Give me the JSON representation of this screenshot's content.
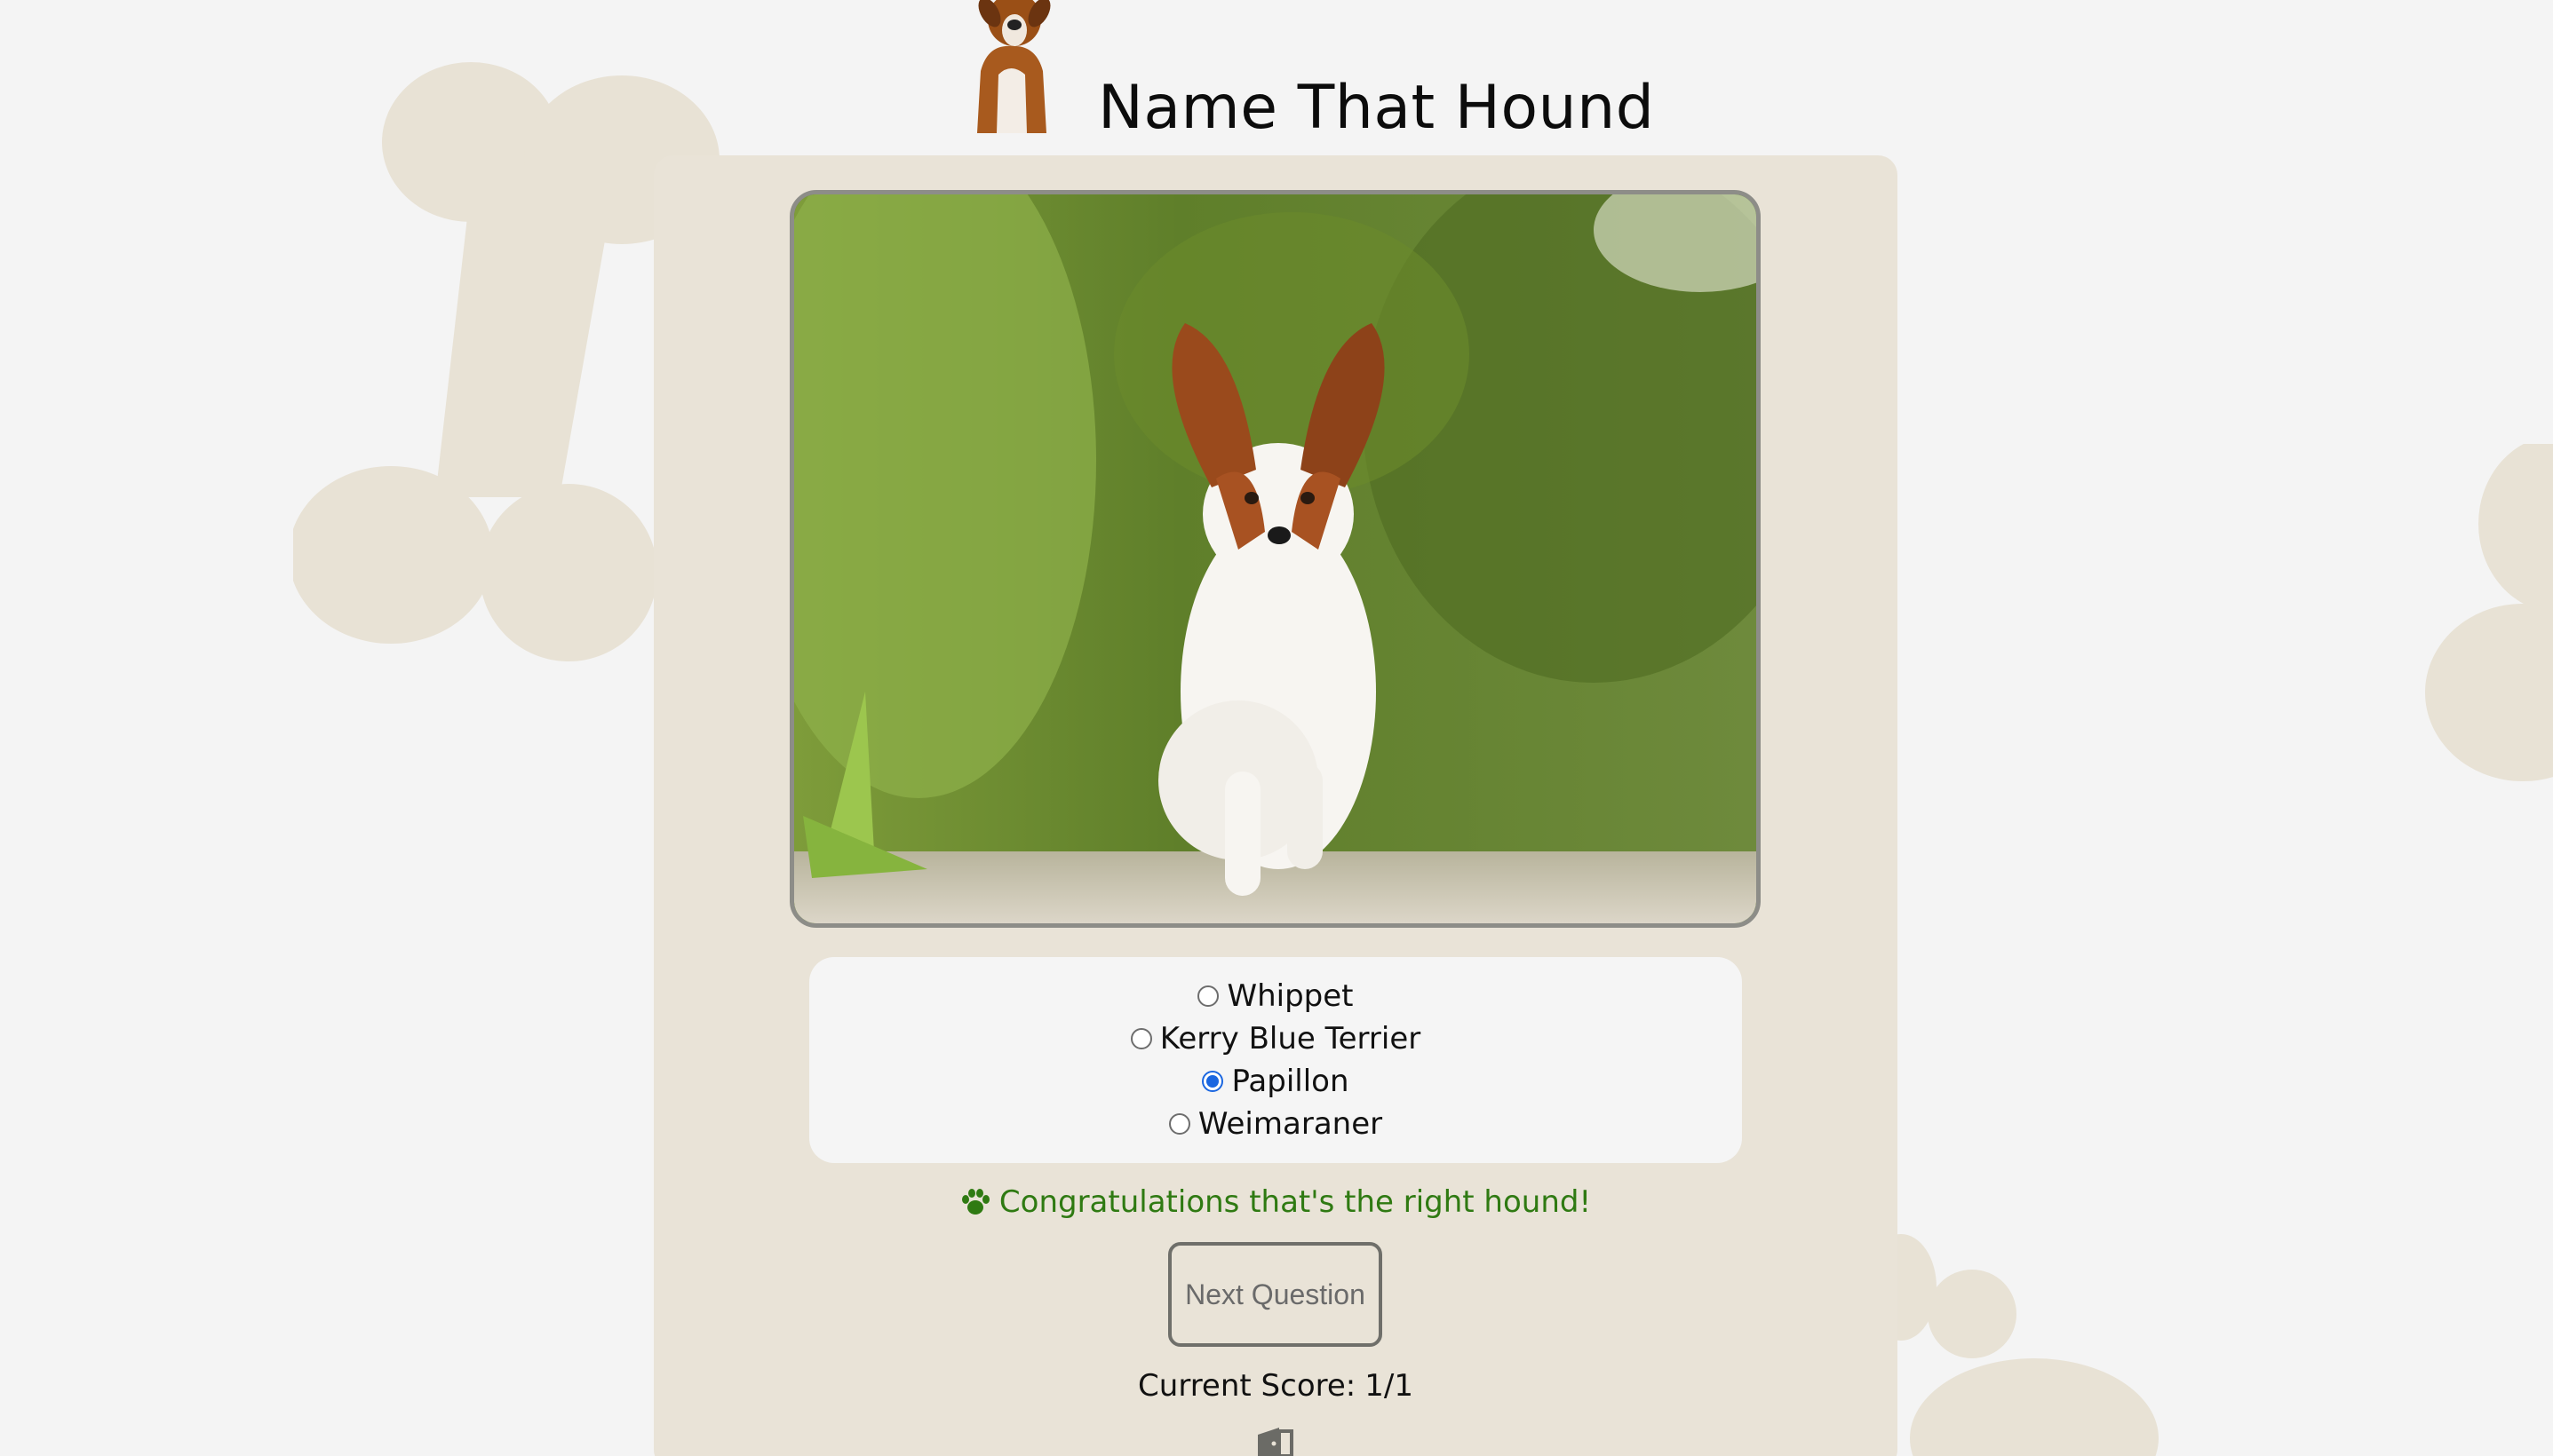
{
  "header": {
    "title": "Name That Hound",
    "logo_icon": "boxer-dog-icon"
  },
  "quiz": {
    "image_subject": "papillon-dog-photo",
    "options": [
      {
        "label": "Whippet",
        "selected": false
      },
      {
        "label": "Kerry Blue Terrier",
        "selected": false
      },
      {
        "label": "Papillon",
        "selected": true
      },
      {
        "label": "Weimaraner",
        "selected": false
      }
    ],
    "feedback": "Congratulations that's the right hound!",
    "feedback_icon": "paw-icon",
    "next_button": "Next Question",
    "score_label": "Current Score:",
    "score_value": "1/1",
    "exit_icon": "door-exit-icon"
  },
  "colors": {
    "background": "#f4f4f4",
    "card": "#e9e3d7",
    "bone": "#e8e2d5",
    "success": "#2f7a12",
    "radio_selected": "#1a66e0"
  }
}
